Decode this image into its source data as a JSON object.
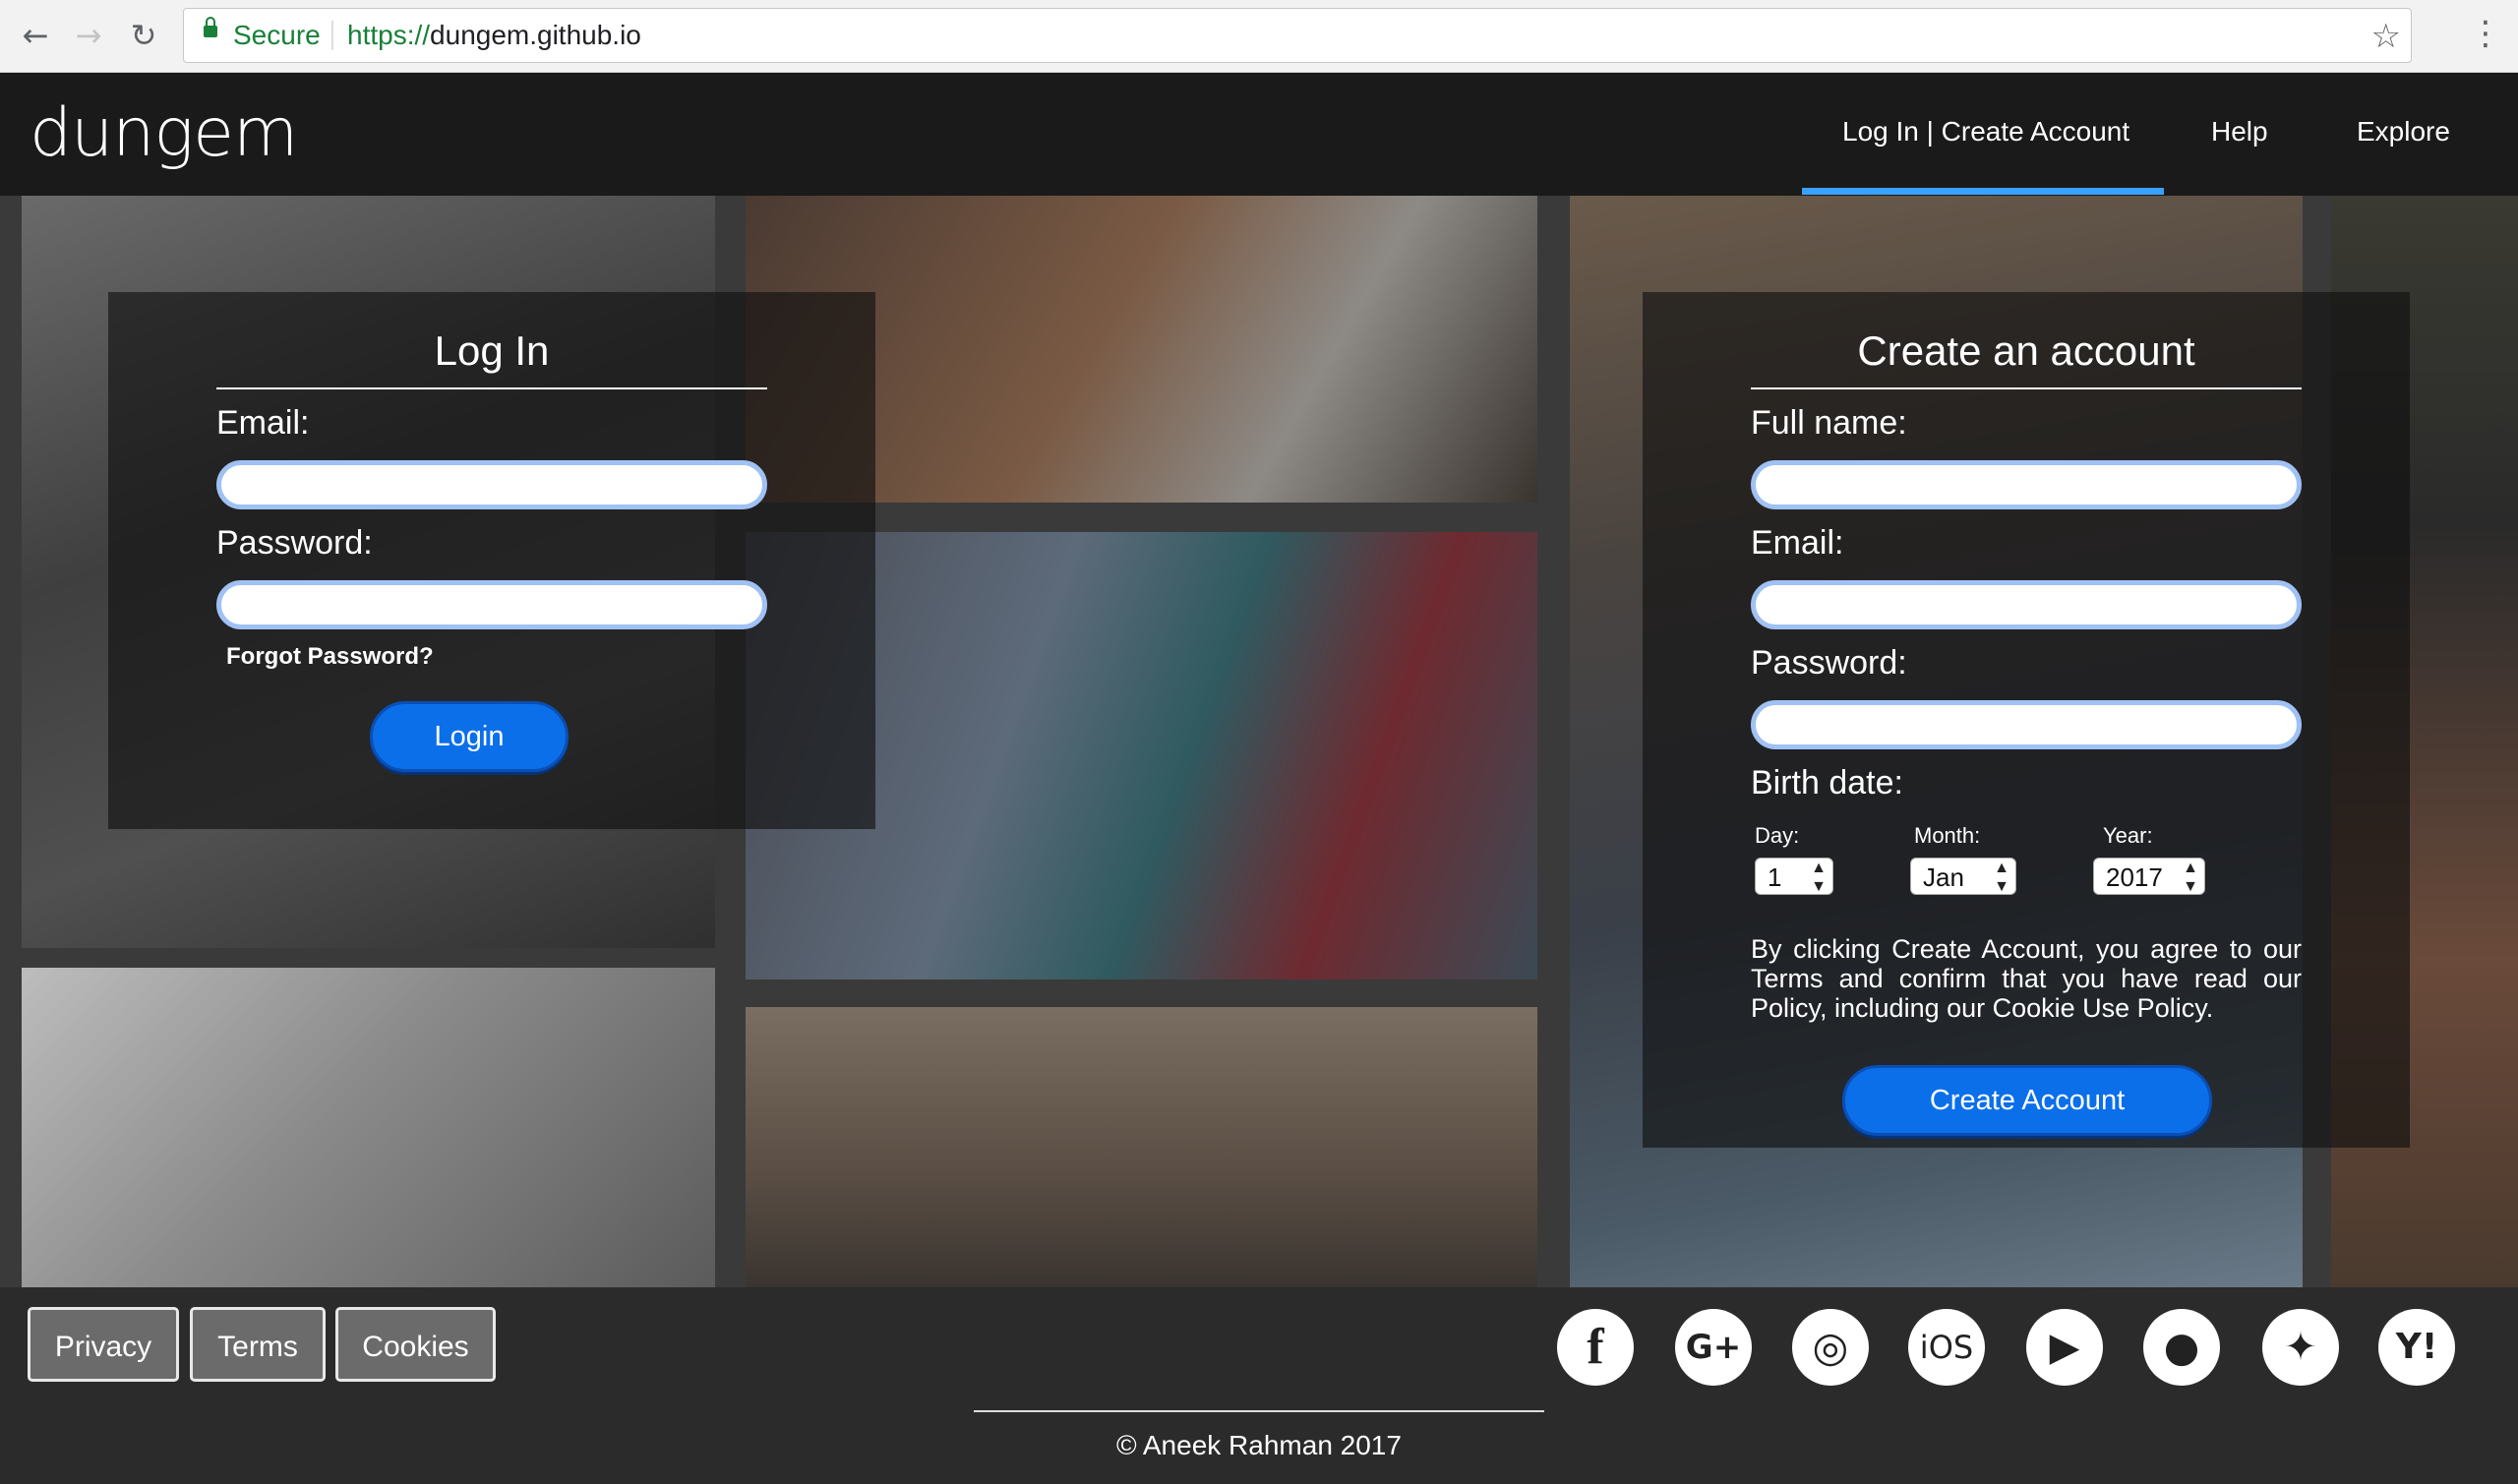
{
  "browser": {
    "secure_label": "Secure",
    "url_scheme": "https://",
    "url_host": "dungem.github.io"
  },
  "header": {
    "logo": "dungem",
    "nav": [
      "Log In | Create Account",
      "Help",
      "Explore"
    ],
    "active_nav": "Log In | Create Account",
    "accent_color": "#3aa1ff"
  },
  "login": {
    "title": "Log In",
    "email_label": "Email:",
    "password_label": "Password:",
    "forgot": "Forgot Password?",
    "button": "Login"
  },
  "signup": {
    "title": "Create an account",
    "fullname_label": "Full name:",
    "email_label": "Email:",
    "password_label": "Password:",
    "birth_label": "Birth date:",
    "day_label": "Day:",
    "month_label": "Month:",
    "year_label": "Year:",
    "day_value": "1",
    "month_value": "Jan",
    "year_value": "2017",
    "terms_text": "By clicking Create Account, you agree to our Terms and confirm that you have read our Policy, including our Cookie Use Policy.",
    "button": "Create Account"
  },
  "footer": {
    "links": [
      "Privacy",
      "Terms",
      "Cookies"
    ],
    "social": [
      "f",
      "G+",
      "◎",
      "iOS",
      "▶",
      "●",
      "✦",
      "Y!"
    ],
    "copyright": "© Aneek Rahman 2017"
  }
}
